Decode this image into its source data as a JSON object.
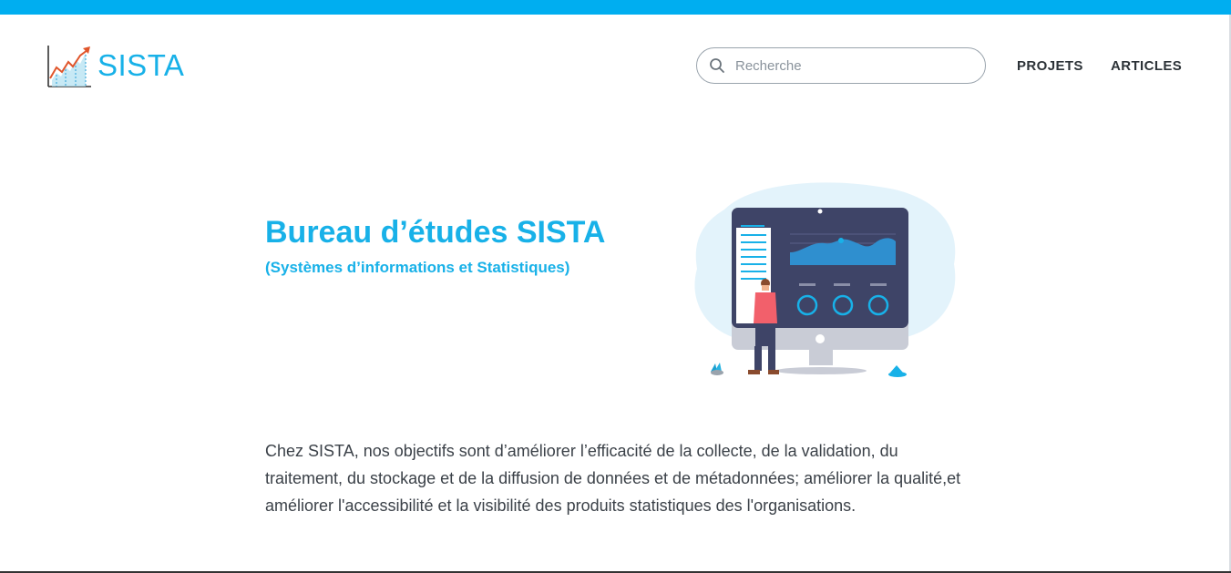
{
  "header": {
    "logo_text": "SISTA",
    "search": {
      "placeholder": "Recherche",
      "value": ""
    },
    "nav": {
      "projets": "PROJETS",
      "articles": "ARTICLES"
    }
  },
  "hero": {
    "title": "Bureau d’études SISTA",
    "subtitle": "(Systèmes d’informations et Statistiques)"
  },
  "description": "Chez SISTA, nos objectifs sont d’améliorer l’efficacité de la collecte, de la validation, du traitement, du stockage et de la diffusion de données et de métadonnées; améliorer la qualité,et améliorer l'accessibilité et la visibilité des produits statistiques des l'organisations.",
  "colors": {
    "accent": "#18b1e8",
    "top_bar": "#00aef0",
    "text": "#3b4148",
    "nav_text": "#2d3338"
  },
  "icons": [
    "logo-chart-icon",
    "search-icon",
    "dashboard-illustration"
  ]
}
